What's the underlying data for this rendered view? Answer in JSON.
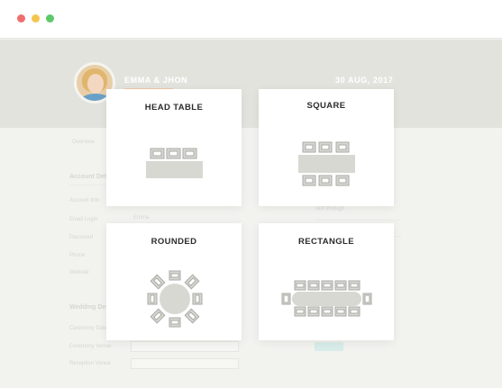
{
  "window": {
    "controls": [
      "close-dot",
      "minimize-dot",
      "maximize-dot"
    ]
  },
  "header": {
    "couple_names": "EMMA & JHON",
    "date": "30 AUG, 2017"
  },
  "background_form": {
    "breadcrumb": "Overview",
    "section_account": "Account Details",
    "subsection_account_info": "Account Info",
    "field_labels": [
      "Email Login",
      "Password",
      "Phone",
      "Website"
    ],
    "section_wedding": "Wedding Details",
    "wedding_labels": [
      "Ceremony Date",
      "Ceremony Venue",
      "Reception Venue"
    ],
    "value_sample": "Emma",
    "right_heading": "Text through",
    "button_label": "Save Details"
  },
  "table_options": [
    {
      "id": "head-table",
      "label": "HEAD TABLE",
      "icon": "head-table-icon"
    },
    {
      "id": "square",
      "label": "SQUARE",
      "icon": "square-table-icon"
    },
    {
      "id": "rounded",
      "label": "ROUNDED",
      "icon": "rounded-table-icon"
    },
    {
      "id": "rectangle",
      "label": "RECTANGLE",
      "icon": "rectangle-table-icon"
    }
  ],
  "colors": {
    "icon_fill": "#d8d8d3",
    "icon_stroke": "#a9a9a4",
    "accent": "#f0c9a6"
  }
}
